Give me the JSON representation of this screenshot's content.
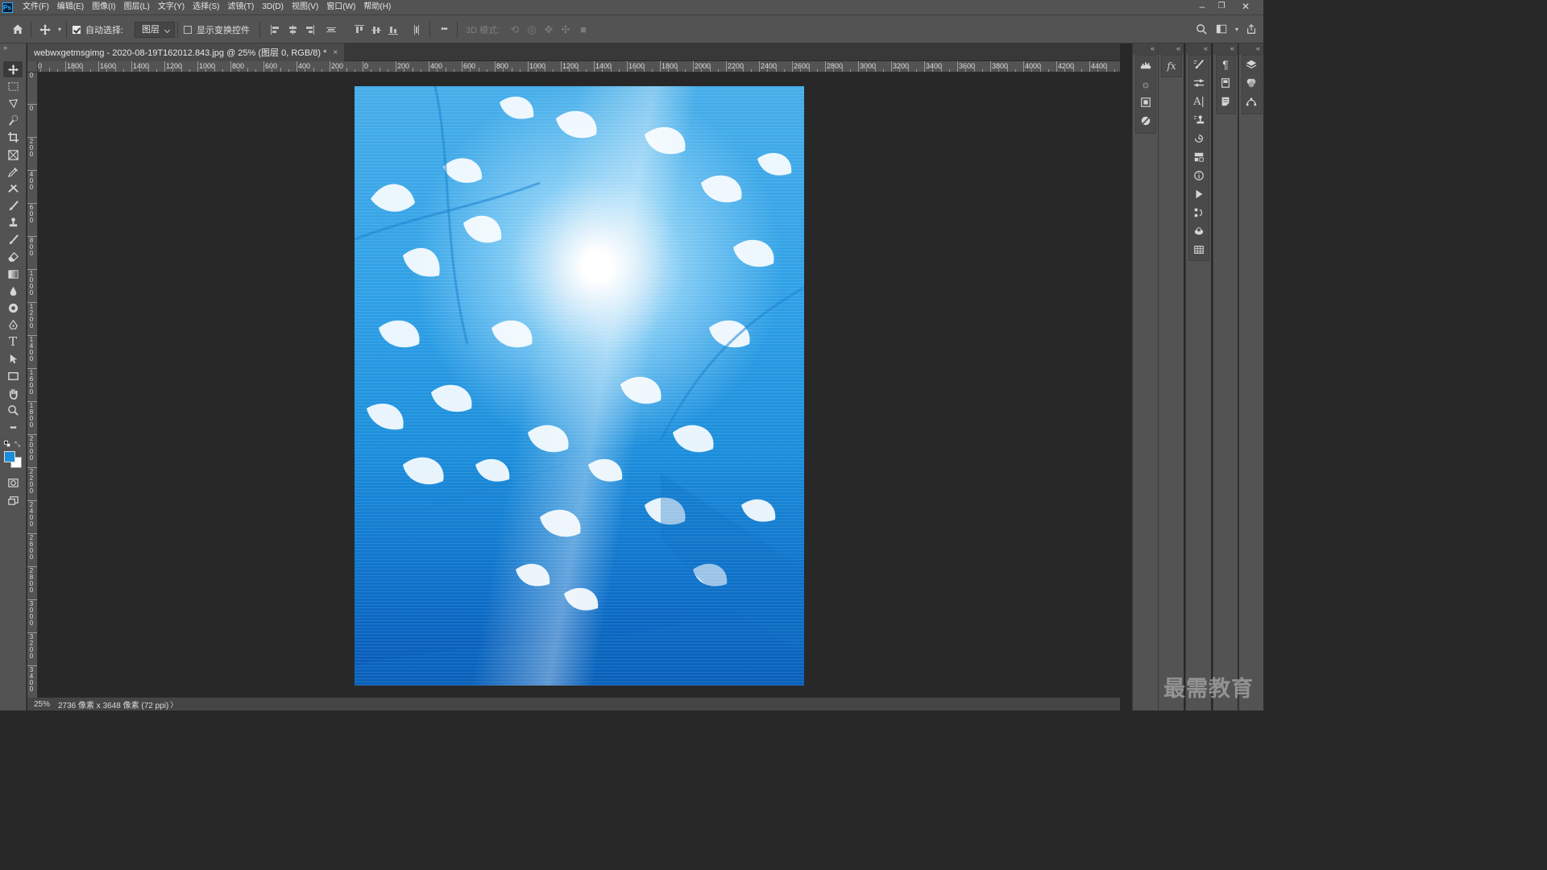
{
  "app": {
    "logo_text": "Ps"
  },
  "menu": {
    "items": [
      {
        "label": "文件(F)"
      },
      {
        "label": "编辑(E)"
      },
      {
        "label": "图像(I)"
      },
      {
        "label": "图层(L)"
      },
      {
        "label": "文字(Y)"
      },
      {
        "label": "选择(S)"
      },
      {
        "label": "滤镜(T)"
      },
      {
        "label": "3D(D)"
      },
      {
        "label": "视图(V)"
      },
      {
        "label": "窗口(W)"
      },
      {
        "label": "帮助(H)"
      }
    ]
  },
  "window_controls": {
    "minimize": "–",
    "restore": "❐",
    "close": "✕"
  },
  "options_bar": {
    "auto_select_label": "自动选择:",
    "auto_select_checked": true,
    "target_select_value": "图层",
    "show_transform_label": "显示变换控件",
    "show_transform_checked": false,
    "more_label": "•••",
    "mode_3d_label": "3D 模式:"
  },
  "document": {
    "tab_title": "webwxgetmsgimg - 2020-08-19T162012.843.jpg @ 25% (图层 0, RGB/8) *",
    "close_symbol": "×"
  },
  "ruler_top": {
    "labels": [
      "00",
      "1800",
      "1600",
      "1400",
      "1200",
      "1000",
      "800",
      "600",
      "400",
      "200",
      "0",
      "200",
      "400",
      "600",
      "800",
      "1000",
      "1200",
      "1400",
      "1600",
      "1800",
      "2000",
      "2200",
      "2400",
      "2600",
      "2800",
      "3000",
      "3200",
      "3400",
      "3600",
      "3800",
      "4000",
      "4200",
      "4400",
      "46"
    ]
  },
  "ruler_left": {
    "labels": [
      "0",
      "0",
      "200",
      "400",
      "600",
      "800",
      "1000",
      "1200",
      "1400",
      "1600",
      "1800",
      "2000",
      "2200",
      "2400",
      "2600",
      "2800",
      "3000",
      "3200",
      "3400",
      "36"
    ]
  },
  "status": {
    "zoom": "25%",
    "doc_info": "2736 像素 x 3648 像素 (72 ppi)",
    "arrow": "〉"
  },
  "colors": {
    "foreground": "#1a8fdb",
    "background": "#ffffff"
  },
  "watermark": {
    "text": "最需教育"
  }
}
